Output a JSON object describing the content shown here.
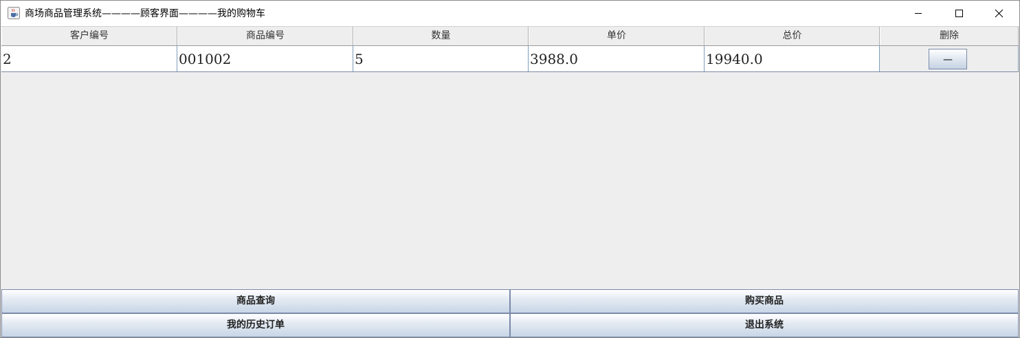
{
  "window": {
    "title": "商场商品管理系统————顾客界面————我的购物车",
    "icon": "java-cup-icon"
  },
  "table": {
    "columns": [
      "客户编号",
      "商品编号",
      "数量",
      "单价",
      "总价",
      "删除"
    ],
    "rows": [
      {
        "customer_id": "2",
        "product_id": "001002",
        "quantity": "5",
        "unit_price": "3988.0",
        "total_price": "19940.0",
        "delete_label": "—"
      }
    ]
  },
  "buttons": {
    "query": "商品查询",
    "buy": "购买商品",
    "history": "我的历史订单",
    "exit": "退出系统"
  }
}
